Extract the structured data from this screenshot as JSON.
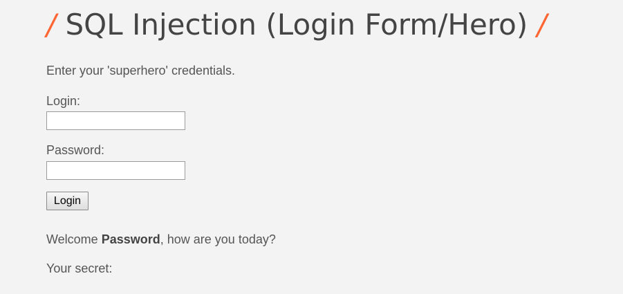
{
  "header": {
    "slash_left": "/",
    "title": "SQL Injection (Login Form/Hero)",
    "slash_right": "/"
  },
  "form": {
    "intro": "Enter your 'superhero' credentials.",
    "login_label": "Login:",
    "login_value": "",
    "password_label": "Password:",
    "password_value": "",
    "submit_label": "Login"
  },
  "result": {
    "welcome_prefix": "Welcome ",
    "welcome_name": "Password",
    "welcome_suffix": ", how are you today?",
    "secret_label": "Your secret:"
  },
  "colors": {
    "accent": "#ff6633",
    "background": "#f3f3f3",
    "text": "#555555"
  }
}
